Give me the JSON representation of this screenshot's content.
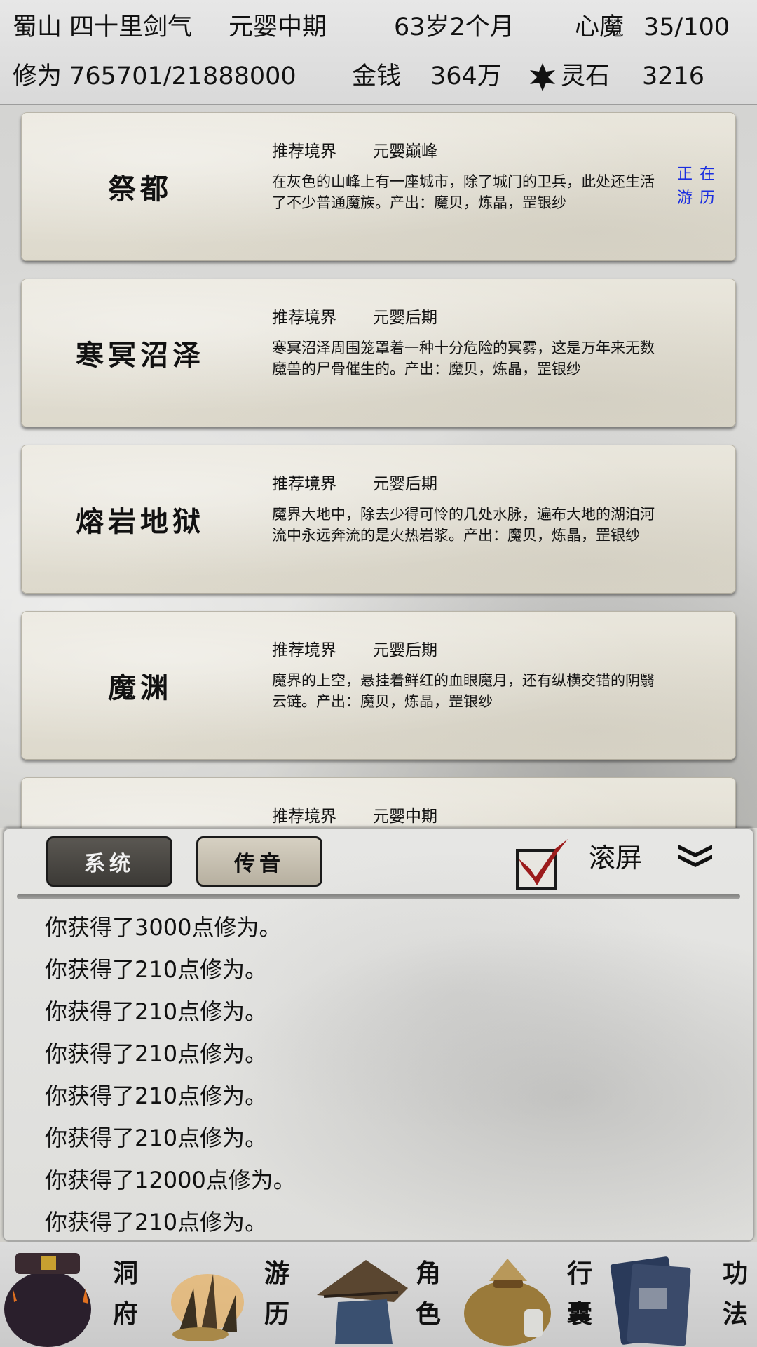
{
  "status": {
    "sect": "蜀山 四十里剑气",
    "realm": "元婴中期",
    "age": "63岁2个月",
    "demon_label": "心魔",
    "demon_value": "35/100",
    "cultivation": "修为 765701/21888000",
    "money_label": "金钱",
    "money_value": "364万",
    "stone_label": "灵石",
    "stone_value": "3216"
  },
  "locations": [
    {
      "name": "祭都",
      "rec_label": "推荐境界",
      "rec_value": "元婴巅峰",
      "desc": "在灰色的山峰上有一座城市，除了城门的卫兵，此处还生活了不少普通魔族。产出：魔贝，炼晶，罡银纱",
      "active": "正在游历"
    },
    {
      "name": "寒冥沼泽",
      "rec_label": "推荐境界",
      "rec_value": "元婴后期",
      "desc": "寒冥沼泽周围笼罩着一种十分危险的冥雾，这是万年来无数魔兽的尸骨催生的。产出：魔贝，炼晶，罡银纱",
      "active": ""
    },
    {
      "name": "熔岩地狱",
      "rec_label": "推荐境界",
      "rec_value": "元婴后期",
      "desc": "魔界大地中，除去少得可怜的几处水脉，遍布大地的湖泊河流中永远奔流的是火热岩浆。产出：魔贝，炼晶，罡银纱",
      "active": ""
    },
    {
      "name": "魔渊",
      "rec_label": "推荐境界",
      "rec_value": "元婴后期",
      "desc": "魔界的上空，悬挂着鲜红的血眼魔月，还有纵横交错的阴翳云链。产出：魔贝，炼晶，罡银纱",
      "active": ""
    },
    {
      "name": "",
      "rec_label": "推荐境界",
      "rec_value": "元婴中期",
      "desc": "",
      "active": ""
    }
  ],
  "messages": {
    "tab_system": "系统",
    "tab_voice": "传音",
    "scroll_label": "滚屏",
    "scroll_checked": true,
    "lines": [
      "你获得了3000点修为。",
      "你获得了210点修为。",
      "你获得了210点修为。",
      "你获得了210点修为。",
      "你获得了210点修为。",
      "你获得了210点修为。",
      "你获得了12000点修为。",
      "你获得了210点修为。"
    ]
  },
  "nav": [
    {
      "label_top": "洞",
      "label_bottom": "府",
      "icon": "cave-dwelling-icon"
    },
    {
      "label_top": "游",
      "label_bottom": "历",
      "icon": "travel-icon"
    },
    {
      "label_top": "角",
      "label_bottom": "色",
      "icon": "character-hat-icon"
    },
    {
      "label_top": "行",
      "label_bottom": "囊",
      "icon": "bag-icon"
    },
    {
      "label_top": "功",
      "label_bottom": "法",
      "icon": "book-icon"
    }
  ],
  "colors": {
    "active_blue": "#1a2ee0",
    "check_red": "#9c1b1b"
  }
}
